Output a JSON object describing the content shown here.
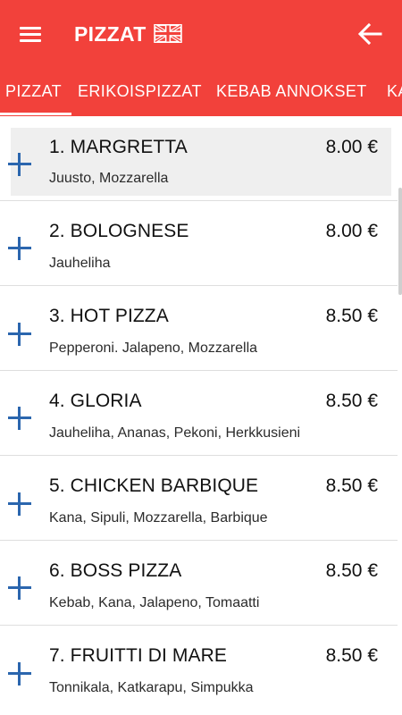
{
  "app_bar": {
    "title": "PIZZAT",
    "language_flag": "uk-flag-icon",
    "menu_icon": "hamburger-menu-icon",
    "back_icon": "arrow-back-icon",
    "background_color": "#f2413b"
  },
  "tabs": [
    {
      "label": "PIZZAT",
      "active": true
    },
    {
      "label": "ERIKOISPIZZAT",
      "active": false
    },
    {
      "label": "KEBAB ANNOKSET",
      "active": false
    },
    {
      "label": "KA",
      "active": false
    }
  ],
  "menu_items": [
    {
      "name": "1. MARGRETTA",
      "price": "8.00 €",
      "description": "Juusto, Mozzarella",
      "selected": true
    },
    {
      "name": "2. BOLOGNESE",
      "price": "8.00 €",
      "description": "Jauheliha",
      "selected": false
    },
    {
      "name": "3. HOT PIZZA",
      "price": "8.50 €",
      "description": "Pepperoni. Jalapeno, Mozzarella",
      "selected": false
    },
    {
      "name": "4. GLORIA",
      "price": "8.50 €",
      "description": "Jauheliha, Ananas, Pekoni, Herkkusieni",
      "selected": false
    },
    {
      "name": "5. CHICKEN BARBIQUE",
      "price": "8.50 €",
      "description": "Kana, Sipuli, Mozzarella, Barbique",
      "selected": false
    },
    {
      "name": "6. BOSS PIZZA",
      "price": "8.50 €",
      "description": "Kebab, Kana, Jalapeno, Tomaatti",
      "selected": false
    },
    {
      "name": "7. FRUITTI DI MARE",
      "price": "8.50 €",
      "description": "Tonnikala, Katkarapu, Simpukka",
      "selected": false
    }
  ],
  "colors": {
    "accent": "#f2413b",
    "add_icon": "#2b66ae"
  }
}
